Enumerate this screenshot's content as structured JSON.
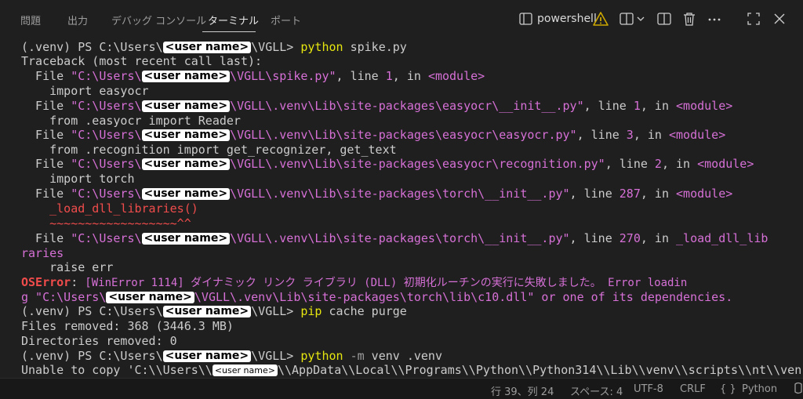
{
  "tabs": [
    {
      "label": "問題"
    },
    {
      "label": "出力"
    },
    {
      "label": "デバッグ コンソール"
    },
    {
      "label": "ターミナル"
    },
    {
      "label": "ポート"
    }
  ],
  "terminal_toolbar": {
    "shell_name": "powershell"
  },
  "masked_label": "<user name>",
  "terminal_lines": {
    "l01": {
      "a": "(.venv) PS C:\\Users\\",
      "b": "\\VGLL> ",
      "cmd": "python",
      "c": " spike.py"
    },
    "l02": {
      "a": "Traceback (most recent call last):"
    },
    "l03": {
      "a": "  File ",
      "p1": "\"C:\\Users\\",
      "p2": "\\VGLL\\spike.py\"",
      "b": ", line ",
      "n": "1",
      "c": ", in ",
      "m": "<module>"
    },
    "l04": {
      "a": "    import easyocr"
    },
    "l05": {
      "a": "  File ",
      "p1": "\"C:\\Users\\",
      "p2": "\\VGLL\\.venv\\Lib\\site-packages\\easyocr\\__init__.py\"",
      "b": ", line ",
      "n": "1",
      "c": ", in ",
      "m": "<module>"
    },
    "l06": {
      "a": "    from .easyocr import Reader"
    },
    "l07": {
      "a": "  File ",
      "p1": "\"C:\\Users\\",
      "p2": "\\VGLL\\.venv\\Lib\\site-packages\\easyocr\\easyocr.py\"",
      "b": ", line ",
      "n": "3",
      "c": ", in ",
      "m": "<module>"
    },
    "l08": {
      "a": "    from .recognition import get_recognizer, get_text"
    },
    "l09": {
      "a": "  File ",
      "p1": "\"C:\\Users\\",
      "p2": "\\VGLL\\.venv\\Lib\\site-packages\\easyocr\\recognition.py\"",
      "b": ", line ",
      "n": "2",
      "c": ", in ",
      "m": "<module>"
    },
    "l10": {
      "a": "    import torch"
    },
    "l11": {
      "a": "  File ",
      "p1": "\"C:\\Users\\",
      "p2": "\\VGLL\\.venv\\Lib\\site-packages\\torch\\__init__.py\"",
      "b": ", line ",
      "n": "287",
      "c": ", in ",
      "m": "<module>"
    },
    "l12": {
      "a": "    ",
      "e": "_load_dll_libraries()"
    },
    "l13": {
      "a": "    ",
      "e": "~~~~~~~~~~~~~~~~~~^^"
    },
    "l14": {
      "a": "  File ",
      "p1": "\"C:\\Users\\",
      "p2": "\\VGLL\\.venv\\Lib\\site-packages\\torch\\__init__.py\"",
      "b": ", line ",
      "n": "270",
      "c": ", in ",
      "m": "_load_dll_lib"
    },
    "l15": {
      "m": "raries"
    },
    "l16": {
      "a": "    raise err"
    },
    "l17": {
      "e": "OSError",
      "a": ": ",
      "m": "[WinError 1114] ダイナミック リンク ライブラリ (DLL) 初期化ルーチンの実行に失敗しました。 Error loadin"
    },
    "l18": {
      "m1": "g \"C:\\Users\\",
      "m2": "\\VGLL\\.venv\\Lib\\site-packages\\torch\\lib\\c10.dll\" or one of its dependencies."
    },
    "l19": {
      "a": "(.venv) PS C:\\Users\\",
      "b": "\\VGLL> ",
      "cmd": "pip",
      "c": " cache purge"
    },
    "l20": {
      "a": "Files removed: 368 (3446.3 MB)"
    },
    "l21": {
      "a": "Directories removed: 0"
    },
    "l22": {
      "a": "(.venv) PS C:\\Users\\",
      "b": "\\VGLL> ",
      "cmd": "python",
      "flag": " -m",
      "c": " venv .venv"
    },
    "l23": {
      "a": "Unable to copy 'C:\\\\Users\\\\",
      "b": "\\\\AppData\\\\Local\\\\Programs\\\\Python\\\\Python314\\\\Lib\\\\venv\\\\scripts\\\\nt\\\\ven"
    }
  },
  "status_bar": {
    "position": "行 39、列 24",
    "spaces": "スペース: 4",
    "encoding": "UTF-8",
    "eol": "CRLF",
    "lang_braces": "{ }",
    "language": "Python"
  },
  "colors": {
    "background": "#1f1f1f",
    "text": "#cccccc",
    "command": "#e5e510",
    "magenta": "#d670d6",
    "error_red": "#f14c4c",
    "warning": "#cca700"
  },
  "icons": [
    "terminal-icon",
    "warning-icon",
    "split-terminal-icon",
    "chevron-down-icon",
    "layout-icon",
    "trash-icon",
    "more-icon",
    "maximize-icon",
    "close-icon"
  ]
}
